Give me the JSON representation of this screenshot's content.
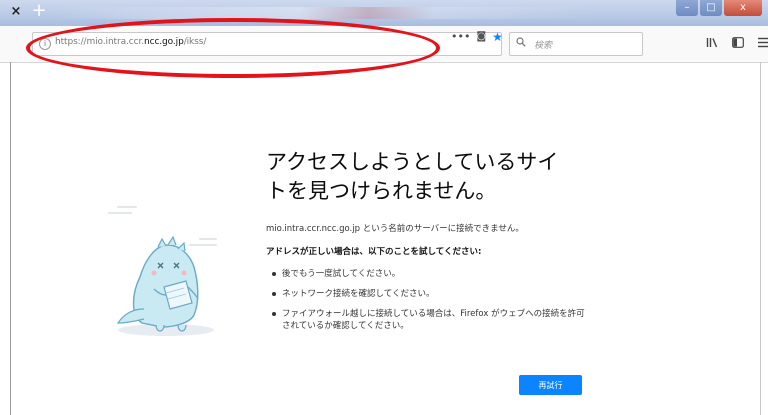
{
  "tab": {
    "close_glyph": "×",
    "new_tab_glyph": "+"
  },
  "window_controls": [
    "–",
    "□",
    "x"
  ],
  "urlbar": {
    "scheme": "https://",
    "host_prefix": "mio.intra.ccr.",
    "host": "ncc.go.jp",
    "path": "/ikss/",
    "info_glyph": "i"
  },
  "page_actions": [
    {
      "name": "page-actions-menu-icon",
      "glyph": "•••"
    },
    {
      "name": "pocket-icon",
      "glyph": "◙"
    },
    {
      "name": "bookmark-star-icon",
      "glyph": "★"
    }
  ],
  "searchbar": {
    "icon": "search-icon",
    "placeholder": "検索"
  },
  "toolbar_icons": [
    {
      "name": "library-icon",
      "glyph": "\\"
    },
    {
      "name": "sidebar-icon",
      "glyph": "◫"
    },
    {
      "name": "menu-icon",
      "glyph": "≡"
    }
  ],
  "error_page": {
    "title_line1": "アクセスしようとしているサイ",
    "title_line2": "トを見つけられません。",
    "description": "mio.intra.ccr.ncc.go.jp という名前のサーバーに接続できません。",
    "subheading": "アドレスが正しい場合は、以下のことを試してください:",
    "suggestions": [
      "後でもう一度試してください。",
      "ネットワーク接続を確認してください。",
      "ファイアウォール越しに接続している場合は、Firefox がウェブへの接続を許可されているか確認してください。"
    ],
    "retry_label": "再試行"
  },
  "colors": {
    "accent": "#0a84ff",
    "annotation": "#e3121b",
    "title": "#0c0c0d"
  }
}
